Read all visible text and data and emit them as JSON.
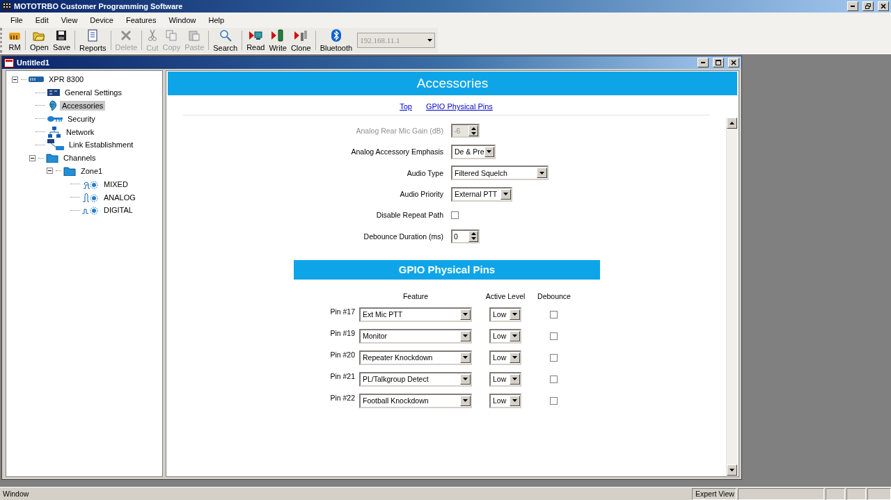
{
  "app_title": "MOTOTRBO Customer Programming Software",
  "menu": [
    "File",
    "Edit",
    "View",
    "Device",
    "Features",
    "Window",
    "Help"
  ],
  "toolbar": [
    {
      "label": "RM",
      "disabled": false
    },
    {
      "label": "Open",
      "disabled": false
    },
    {
      "label": "Save",
      "disabled": false
    },
    {
      "label": "Reports",
      "disabled": false
    },
    {
      "label": "Delete",
      "disabled": true
    },
    {
      "label": "Cut",
      "disabled": true
    },
    {
      "label": "Copy",
      "disabled": true
    },
    {
      "label": "Paste",
      "disabled": true
    },
    {
      "label": "Search",
      "disabled": false
    },
    {
      "label": "Read",
      "disabled": false
    },
    {
      "label": "Write",
      "disabled": false
    },
    {
      "label": "Clone",
      "disabled": false
    },
    {
      "label": "Bluetooth",
      "disabled": false
    }
  ],
  "address_combo": {
    "value": "192.168.11.1",
    "disabled": true
  },
  "document": {
    "title": "Untitled1"
  },
  "tree": [
    {
      "label": "XPR 8300",
      "kind": "radio",
      "expanded": true,
      "selected": false,
      "children": [
        {
          "label": "General Settings",
          "kind": "settings",
          "selected": false
        },
        {
          "label": "Accessories",
          "kind": "accessory",
          "selected": true
        },
        {
          "label": "Security",
          "kind": "key",
          "selected": false
        },
        {
          "label": "Network",
          "kind": "network",
          "selected": false
        },
        {
          "label": "Link Establishment",
          "kind": "link",
          "selected": false
        },
        {
          "label": "Channels",
          "kind": "folder",
          "expanded": true,
          "selected": false,
          "children": [
            {
              "label": "Zone1",
              "kind": "folder",
              "expanded": true,
              "selected": false,
              "children": [
                {
                  "label": "MIXED",
                  "kind": "mixed",
                  "selected": false
                },
                {
                  "label": "ANALOG",
                  "kind": "analog",
                  "selected": false
                },
                {
                  "label": "DIGITAL",
                  "kind": "digital",
                  "selected": false
                }
              ]
            }
          ]
        }
      ]
    }
  ],
  "page": {
    "title": "Accessories",
    "links": [
      "Top",
      "GPIO Physical Pins"
    ],
    "fields": [
      {
        "label": "Analog Rear Mic Gain (dB)",
        "kind": "spinner",
        "value": "-6",
        "disabled": true
      },
      {
        "label": "Analog Accessory Emphasis",
        "kind": "dropdown",
        "value": "De & Pre",
        "disabled": false
      },
      {
        "label": "Audio Type",
        "kind": "dropdown",
        "value": "Filtered Squelch",
        "disabled": false
      },
      {
        "label": "Audio Priority",
        "kind": "dropdown",
        "value": "External PTT",
        "disabled": false
      },
      {
        "label": "Disable Repeat Path",
        "kind": "checkbox",
        "checked": false,
        "disabled": false
      },
      {
        "label": "Debounce Duration (ms)",
        "kind": "spinner",
        "value": "0",
        "disabled": false
      }
    ],
    "gpio": {
      "title": "GPIO Physical Pins",
      "columns": [
        "Feature",
        "Active Level",
        "Debounce"
      ],
      "pins": [
        {
          "pin": "Pin #17",
          "feature": "Ext Mic PTT",
          "level": "Low",
          "debounce": false
        },
        {
          "pin": "Pin #19",
          "feature": "Monitor",
          "level": "Low",
          "debounce": false
        },
        {
          "pin": "Pin #20",
          "feature": "Repeater Knockdown",
          "level": "Low",
          "debounce": false
        },
        {
          "pin": "Pin #21",
          "feature": "PL/Talkgroup Detect",
          "level": "Low",
          "debounce": false
        },
        {
          "pin": "Pin #22",
          "feature": "Football Knockdown",
          "level": "Low",
          "debounce": false
        }
      ]
    }
  },
  "status_bar": {
    "left": "Window",
    "mode": "Expert View"
  }
}
